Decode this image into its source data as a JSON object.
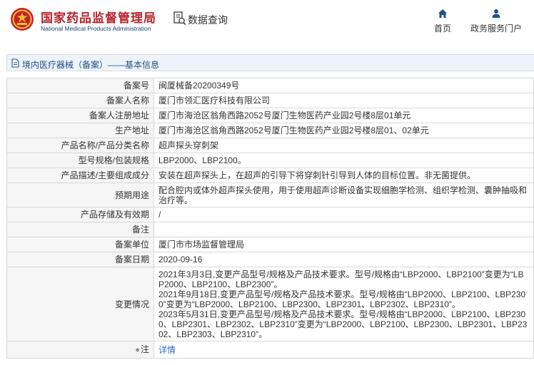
{
  "header": {
    "site_title_cn": "国家药品监督管理局",
    "site_title_en": "National Medical Products Administration",
    "query_label": "数据查询",
    "nav": [
      {
        "label": "首页",
        "icon": "home-icon"
      },
      {
        "label": "政务服务门户",
        "icon": "user-icon"
      }
    ]
  },
  "section": {
    "title": "境内医疗器械（备案）——基本信息"
  },
  "details": {
    "record_no": {
      "label": "备案号",
      "value": "闽厦械备20200349号"
    },
    "filer_name": {
      "label": "备案人名称",
      "value": "厦门市领汇医疗科技有限公司"
    },
    "filer_address": {
      "label": "备案人注册地址",
      "value": "厦门市海沧区翁角西路2052号厦门生物医药产业园2号楼8层01单元"
    },
    "production_address": {
      "label": "生产地址",
      "value": "厦门市海沧区翁角西路2052号厦门生物医药产业园2号楼8层01、02单元"
    },
    "product_name": {
      "label": "产品名称/产品分类名称",
      "value": "超声探头穿刺架"
    },
    "model_spec": {
      "label": "型号规格/包装规格",
      "value": "LBP2000、LBP2100。"
    },
    "description": {
      "label": "产品描述/主要组成成分",
      "value": "安装在超声探头上，在超声的引导下将穿刺针引导到人体的目标位置。非无菌提供。"
    },
    "intended_use": {
      "label": "预期用途",
      "value": "配合腔内或体外超声探头使用，用于使用超声诊断设备实现细胞学检测、组织学检测、囊肿抽吸和治疗等。"
    },
    "storage_validity": {
      "label": "产品存储及有效期",
      "value": "/"
    },
    "remarks": {
      "label": "备注",
      "value": ""
    },
    "record_unit": {
      "label": "备案单位",
      "value": "厦门市市场监督管理局"
    },
    "record_date": {
      "label": "备案日期",
      "value": "2020-09-16"
    },
    "changes": {
      "label": "变更情况",
      "value": "2021年3月3日,变更产品型号/规格及产品技术要求。型号/规格由“LBP2000、LBP2100”变更为“LBP2000、LBP2100、LBP2300”。\n2021年9月18日,变更产品型号/规格及产品技术要求。型号/规格由“LBP2000、LBP2100、LBP2300”变更为“LBP2000、LBP2100、LBP2300、LBP2301、LBP2302、LBP2310”。\n2023年5月31日,变更产品型号/规格及产品技术要求。型号/规格由“LBP2000、LBP2100、LBP2300、LBP2301、LBP2302、LBP2310”变更为“LBP2000、LBP2100、LBP2300、LBP2301、LBP2302、LBP2303、LBP2310”。"
    },
    "note": {
      "label": "注",
      "value": "详情"
    }
  },
  "colors": {
    "brand_red": "#b8232b",
    "nav_blue": "#1f4f87",
    "link_blue": "#2a6cc0",
    "label_bg": "#f5f5f5"
  }
}
